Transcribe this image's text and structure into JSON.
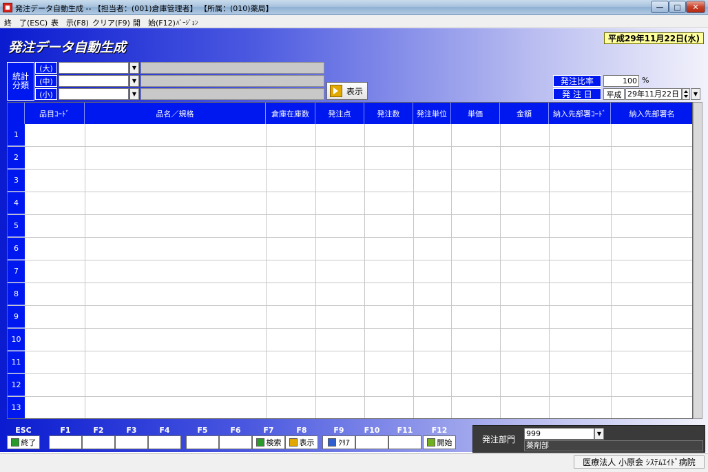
{
  "window": {
    "title": "発注データ自動生成 -- 【担当者：(001)倉庫管理者】 【所属：(010)薬局】"
  },
  "menu": [
    {
      "label": "終　了(ESC)"
    },
    {
      "label": "表　示(F8)"
    },
    {
      "label": "クリア(F9)"
    },
    {
      "label": "開　始(F12)"
    },
    {
      "label": "ﾊﾞｰｼﾞｮﾝ"
    }
  ],
  "form": {
    "title": "発注データ自動生成",
    "date_badge": "平成29年11月22日(水)"
  },
  "classification": {
    "label": "統計分類",
    "levels": [
      {
        "label": "(大)",
        "value": "",
        "name": ""
      },
      {
        "label": "(中)",
        "value": "",
        "name": ""
      },
      {
        "label": "(小)",
        "value": "",
        "name": ""
      }
    ],
    "show_button": "表示"
  },
  "order": {
    "ratio_label": "発注比率",
    "ratio_value": "100",
    "ratio_unit": "%",
    "date_label": "発 注 日",
    "era": "平成",
    "date_value": "29年11月22日"
  },
  "grid": {
    "columns": [
      "品目ｺｰﾄﾞ",
      "品名／規格",
      "倉庫在庫数",
      "発注点",
      "発注数",
      "発注単位",
      "単価",
      "金額",
      "納入先部署ｺｰﾄﾞ",
      "納入先部署名"
    ],
    "row_numbers": [
      "1",
      "2",
      "3",
      "4",
      "5",
      "6",
      "7",
      "8",
      "9",
      "10",
      "11",
      "12",
      "13"
    ]
  },
  "fkeys": [
    {
      "key": "ESC",
      "label": "終了",
      "icon": "exit-icon",
      "color": "#2a9a2a"
    },
    {
      "key": "F1",
      "label": ""
    },
    {
      "key": "F2",
      "label": ""
    },
    {
      "key": "F3",
      "label": ""
    },
    {
      "key": "F4",
      "label": ""
    },
    {
      "key": "F5",
      "label": ""
    },
    {
      "key": "F6",
      "label": ""
    },
    {
      "key": "F7",
      "label": "検索",
      "icon": "search-icon",
      "color": "#2a9a2a"
    },
    {
      "key": "F8",
      "label": "表示",
      "icon": "display-icon",
      "color": "#e0a800"
    },
    {
      "key": "F9",
      "label": "ｸﾘｱ",
      "icon": "clear-icon",
      "color": "#3060d0"
    },
    {
      "key": "F10",
      "label": ""
    },
    {
      "key": "F11",
      "label": ""
    },
    {
      "key": "F12",
      "label": "開始",
      "icon": "start-icon",
      "color": "#70b020"
    }
  ],
  "dept": {
    "label": "発注部門",
    "code": "999",
    "name": "薬剤部"
  },
  "status": {
    "text": "医療法人 小原会 ｼｽﾃﾑｴｲﾄﾞ病院"
  }
}
